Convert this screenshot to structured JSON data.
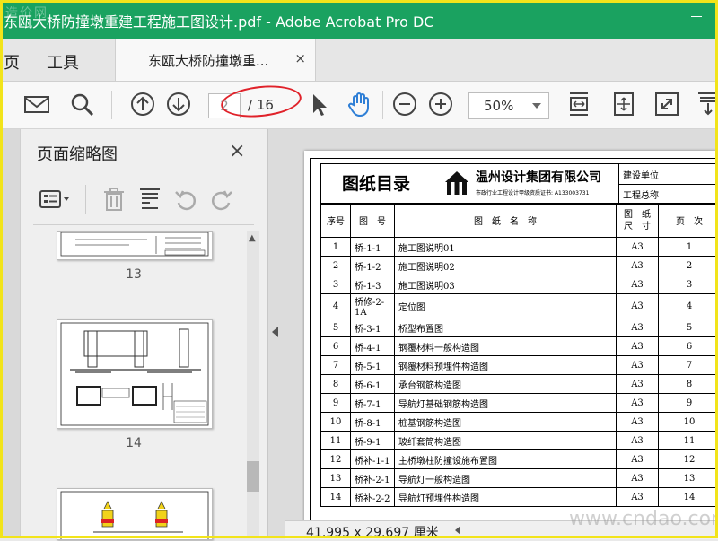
{
  "window": {
    "title": "东瓯大桥防撞墩重建工程施工图设计.pdf - Adobe Acrobat Pro DC",
    "watermark_top": "造价网",
    "watermark_bottom": "www.cndao.com"
  },
  "menu": {
    "home_partial": "页",
    "tools": "工具"
  },
  "tab": {
    "label": "东瓯大桥防撞墩重...",
    "close": "×"
  },
  "toolbar": {
    "current_page": "2",
    "total_pages": "/ 16",
    "zoom": "50%"
  },
  "panel": {
    "title": "页面缩略图",
    "close": "×",
    "thumbnails": [
      {
        "number": "13"
      },
      {
        "number": "14"
      }
    ]
  },
  "sheet": {
    "header_title": "图纸目录",
    "company": "温州设计集团有限公司",
    "certificate": "市政行业工程设计甲级资质证书: A133003731",
    "construction_unit_label": "建设单位",
    "project_name_label": "工程总称",
    "columns": {
      "no": "序号",
      "code": "图　号",
      "name": "图　纸　名　称",
      "size": "图　纸\n尺　寸",
      "page": "页　次"
    },
    "rows": [
      {
        "no": "1",
        "code": "桥-1-1",
        "name": "施工图说明01",
        "size": "A3",
        "page": "1"
      },
      {
        "no": "2",
        "code": "桥-1-2",
        "name": "施工图说明02",
        "size": "A3",
        "page": "2"
      },
      {
        "no": "3",
        "code": "桥-1-3",
        "name": "施工图说明03",
        "size": "A3",
        "page": "3"
      },
      {
        "no": "4",
        "code": "桥修-2-1A",
        "name": "定位图",
        "size": "A3",
        "page": "4"
      },
      {
        "no": "5",
        "code": "桥-3-1",
        "name": "桥型布置图",
        "size": "A3",
        "page": "5"
      },
      {
        "no": "6",
        "code": "桥-4-1",
        "name": "钢覆材料一般构造图",
        "size": "A3",
        "page": "6"
      },
      {
        "no": "7",
        "code": "桥-5-1",
        "name": "钢覆材料预埋件构造图",
        "size": "A3",
        "page": "7"
      },
      {
        "no": "8",
        "code": "桥-6-1",
        "name": "承台钢筋构造图",
        "size": "A3",
        "page": "8"
      },
      {
        "no": "9",
        "code": "桥-7-1",
        "name": "导航灯基础钢筋构造图",
        "size": "A3",
        "page": "9"
      },
      {
        "no": "10",
        "code": "桥-8-1",
        "name": "桩基钢筋构造图",
        "size": "A3",
        "page": "10"
      },
      {
        "no": "11",
        "code": "桥-9-1",
        "name": "玻纤套筒构造图",
        "size": "A3",
        "page": "11"
      },
      {
        "no": "12",
        "code": "桥补-1-1",
        "name": "主桥墩柱防撞设施布置图",
        "size": "A3",
        "page": "12"
      },
      {
        "no": "13",
        "code": "桥补-2-1",
        "name": "导航灯一般构造图",
        "size": "A3",
        "page": "13"
      },
      {
        "no": "14",
        "code": "桥补-2-2",
        "name": "导航灯预埋件构造图",
        "size": "A3",
        "page": "14"
      }
    ]
  },
  "status": {
    "dimensions": "41.995 x 29.697 厘米"
  },
  "colors": {
    "titlebar": "#1aa260",
    "highlight_oval": "#e0222a",
    "frame": "#f2e41a",
    "hand_tool": "#2f7fd6"
  }
}
